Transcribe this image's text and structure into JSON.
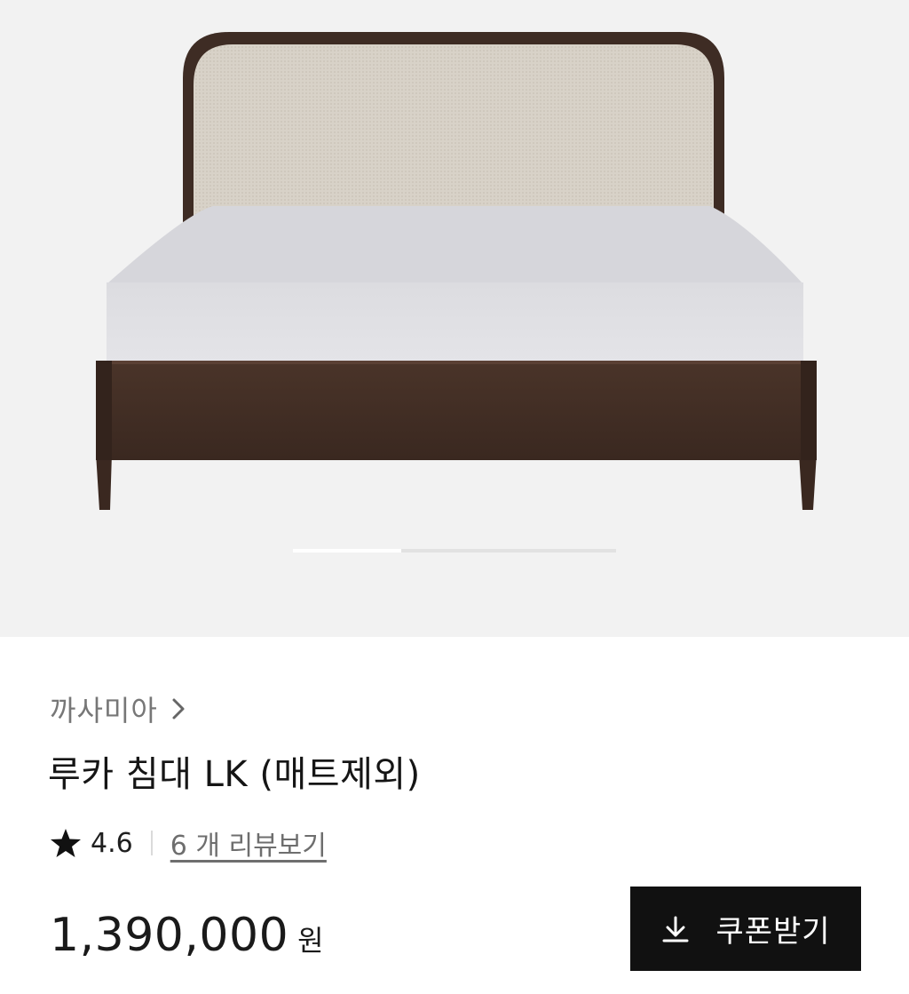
{
  "gallery": {
    "image_alt": "루카 침대 LK",
    "slide_position": {
      "current": 1,
      "total": 3
    }
  },
  "product": {
    "brand": "까사미아",
    "name": "루카 침대 LK (매트제외)",
    "rating": "4.6",
    "review_link": "6 개 리뷰보기",
    "price": "1,390,000",
    "currency": "원"
  },
  "actions": {
    "coupon_button": "쿠폰받기"
  },
  "icons": {
    "brand_chevron": "chevron-right-icon",
    "rating_star": "star-icon",
    "coupon_download": "download-icon"
  },
  "colors": {
    "gallery_background": "#f2f2f2",
    "button_background": "#111111",
    "brand_text": "#777777",
    "review_link_text": "#6e6e6e"
  }
}
